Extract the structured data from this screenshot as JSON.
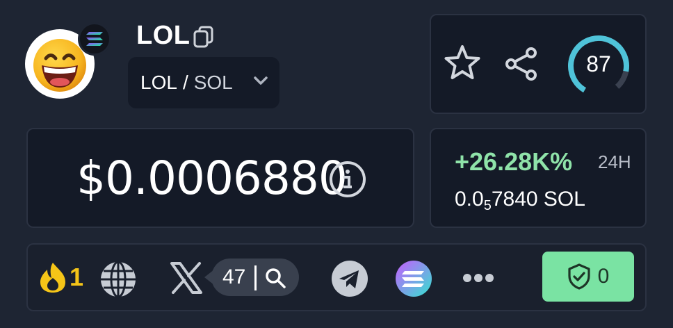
{
  "token": {
    "name": "LOL",
    "pair_base": "LOL",
    "pair_separator": "/",
    "pair_quote": "SOL"
  },
  "price": {
    "usd": "$0.0006880"
  },
  "change": {
    "percent": "+26.28K%",
    "period": "24H",
    "sol_prefix": "0.0",
    "sol_subscript": "5",
    "sol_suffix": "7840 SOL"
  },
  "score": {
    "value": "87",
    "fraction": 0.87
  },
  "links": {
    "fire_count": "1",
    "x_search_count": "47",
    "security_count": "0"
  },
  "icons": {
    "chain": "solana-icon",
    "copy": "copy-icon",
    "chevron": "chevron-down-icon",
    "favorite": "star-icon",
    "share": "share-icon",
    "info": "info-icon",
    "fire": "fire-icon",
    "website": "globe-icon",
    "x": "x-icon",
    "search": "search-icon",
    "telegram": "telegram-icon",
    "explorer": "solana-icon",
    "more": "more-icon",
    "security": "shield-check-icon"
  },
  "colors": {
    "background": "#1e2533",
    "card": "#141a27",
    "positive": "#8fe3a9",
    "score_ring": "#4fc3d9",
    "fire": "#f5c518",
    "security_bg": "#7ae3a3"
  }
}
